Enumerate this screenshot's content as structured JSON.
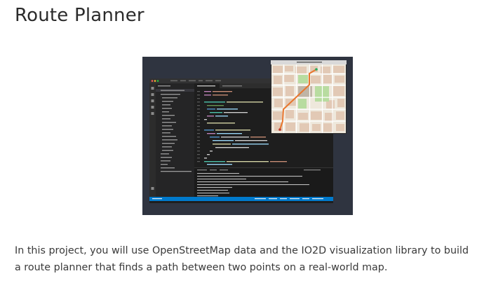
{
  "page": {
    "title": "Route Planner",
    "description": "In this project, you will use OpenStreetMap data and the IO2D visualization library to build a route planner that finds a path between two points on a real-world map."
  },
  "hero_image": {
    "semantic": "project-screenshot",
    "map_window_title": "Streetmap Window"
  },
  "colors": {
    "editor_background": "#1e1e1e",
    "activity_bar": "#2c2c2c",
    "sidebar": "#252526",
    "status_bar": "#007acc",
    "route_line": "#e8772e",
    "map_background": "#eee8dc"
  }
}
